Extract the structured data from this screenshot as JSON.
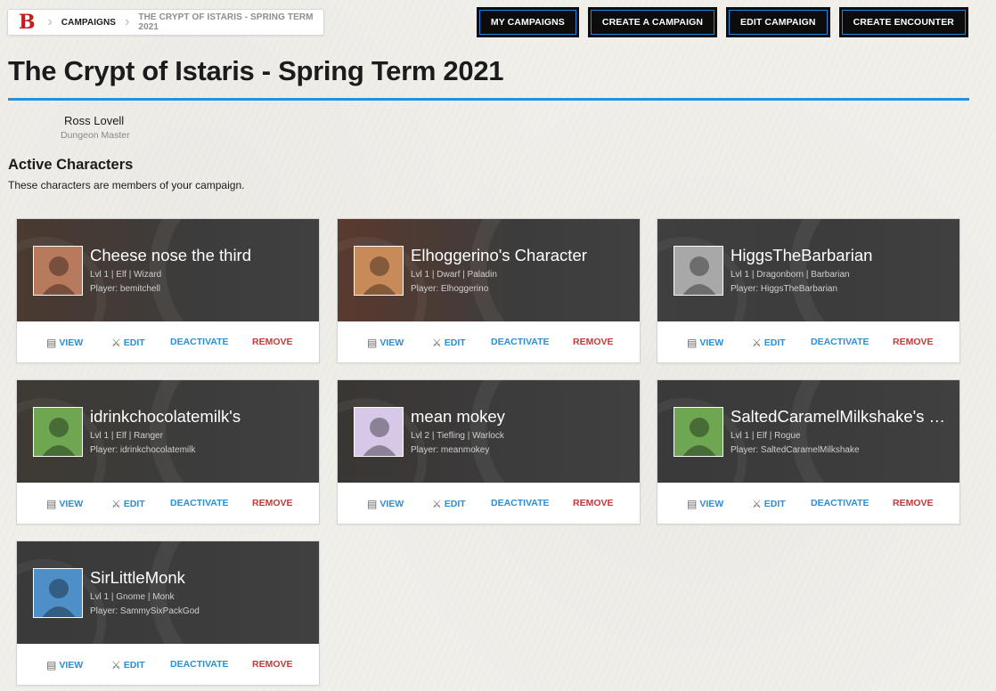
{
  "breadcrumb": {
    "logo": "B",
    "items": [
      "CAMPAIGNS",
      "THE CRYPT OF ISTARIS - SPRING TERM 2021"
    ]
  },
  "nav": {
    "my_campaigns": "MY CAMPAIGNS",
    "create_campaign": "CREATE A CAMPAIGN",
    "edit_campaign": "EDIT CAMPAIGN",
    "create_encounter": "CREATE ENCOUNTER"
  },
  "page": {
    "title": "The Crypt of Istaris - Spring Term 2021",
    "dm_name": "Ross Lovell",
    "dm_role": "Dungeon Master",
    "section_title": "Active Characters",
    "section_subtitle": "These characters are members of your campaign."
  },
  "actions": {
    "view": "VIEW",
    "edit": "EDIT",
    "deactivate": "DEACTIVATE",
    "remove": "REMOVE"
  },
  "characters": [
    {
      "name": "Cheese nose the third",
      "meta": "Lvl 1 | Elf | Wizard",
      "player": "Player: bemitchell",
      "bg": "#4a3a30",
      "avatar": "#b87a5c"
    },
    {
      "name": "Elhoggerino's Character",
      "meta": "Lvl 1 | Dwarf | Paladin",
      "player": "Player: Elhoggerino",
      "bg": "#5a3a2e",
      "avatar": "#c98a5a"
    },
    {
      "name": "HiggsTheBarbarian",
      "meta": "Lvl 1 | Dragonborn | Barbarian",
      "player": "Player: HiggsTheBarbarian",
      "bg": "#3f3f3f",
      "avatar": "#a8a8a8"
    },
    {
      "name": "idrinkchocolatemilk's",
      "meta": "Lvl 1 | Elf | Ranger",
      "player": "Player: idrinkchocolatemilk",
      "bg": "#3e3a33",
      "avatar": "#6ea652"
    },
    {
      "name": "mean mokey",
      "meta": "Lvl 2 | Tiefling | Warlock",
      "player": "Player: meanmokey",
      "bg": "#3a3634",
      "avatar": "#d8c8e8"
    },
    {
      "name": "SaltedCaramelMilkshake's …",
      "meta": "Lvl 1 | Elf | Rogue",
      "player": "Player: SaltedCaramelMilkshake",
      "bg": "#3a3a3a",
      "avatar": "#6ea652"
    },
    {
      "name": "SirLittleMonk",
      "meta": "Lvl 1 | Gnome | Monk",
      "player": "Player: SammySixPackGod",
      "bg": "#3a3a3a",
      "avatar": "#4f8fc8"
    }
  ]
}
